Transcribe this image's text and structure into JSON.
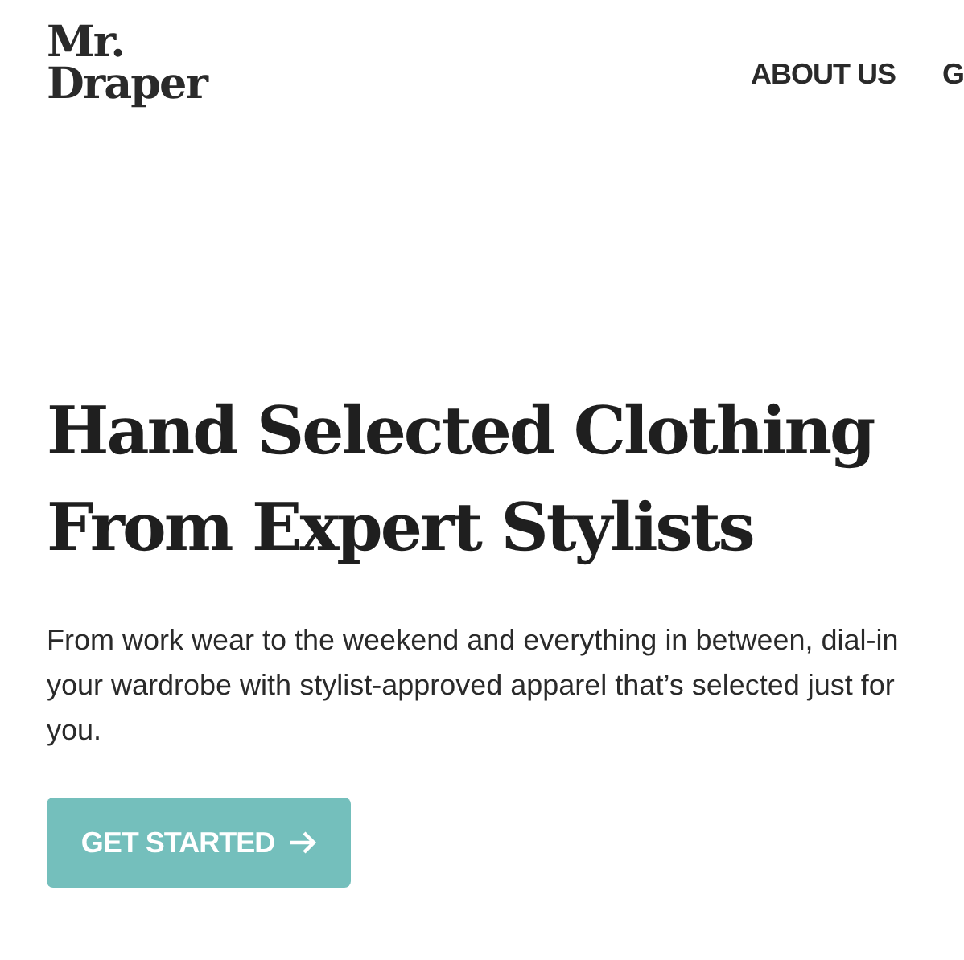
{
  "logo": {
    "lines": [
      "Mr.",
      "Draper"
    ]
  },
  "nav": [
    {
      "label": "ABOUT US"
    },
    {
      "label": "G"
    }
  ],
  "hero": {
    "title_lines": [
      "Hand Selected Clothing",
      "From Expert Stylists"
    ],
    "text": "From work wear to the weekend and everything in between, dial-in your wardrobe with stylist-approved apparel that’s selected just for you.",
    "button": "GET STARTED"
  }
}
